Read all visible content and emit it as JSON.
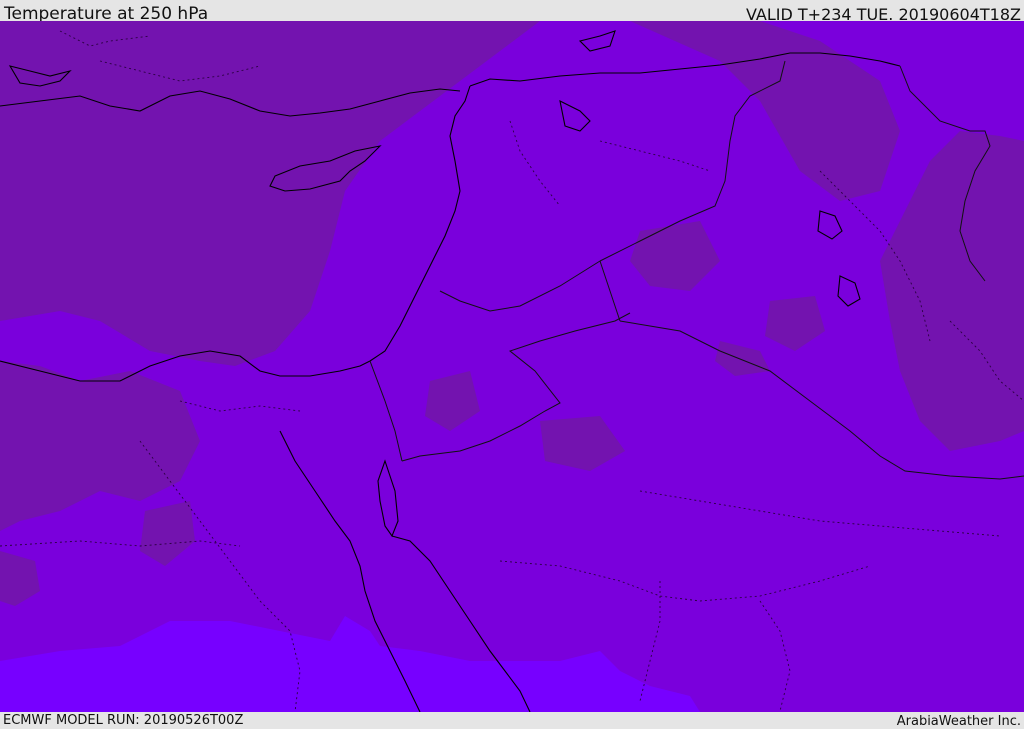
{
  "header": {
    "title": "Temperature at 250 hPa",
    "valid": "VALID T+234 TUE. 20190604T18Z"
  },
  "footer": {
    "model_run": "ECMWF MODEL RUN: 20190526T00Z",
    "credit": "ArabiaWeather Inc."
  },
  "map": {
    "region": "Eastern Mediterranean and Middle East",
    "projection": "Mercator",
    "layers": [
      "temperature-shading",
      "coastlines",
      "country-borders",
      "province-borders"
    ],
    "palette": {
      "cool": "#7313af",
      "mid": "#7a00dc",
      "warm": "#7700ff",
      "coastline": "#000000",
      "border": "#111111"
    }
  }
}
